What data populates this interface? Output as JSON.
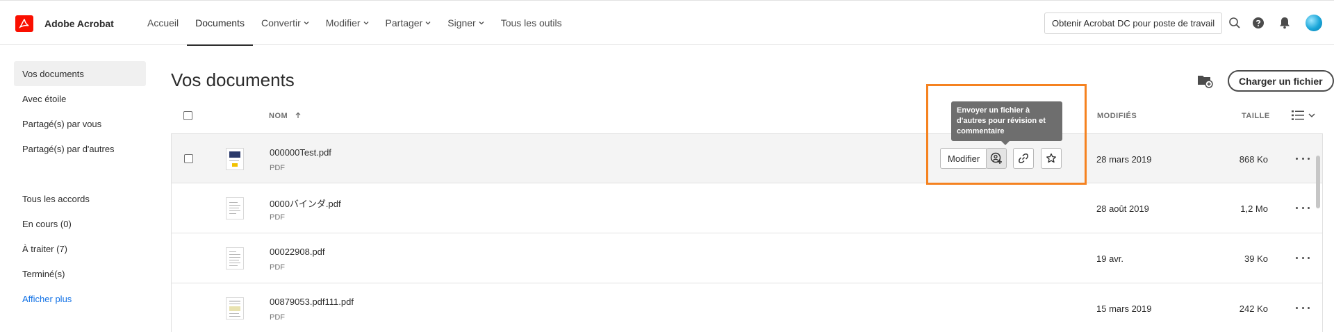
{
  "app": {
    "name": "Adobe Acrobat"
  },
  "nav": [
    {
      "label": "Accueil",
      "dropdown": false,
      "active": false
    },
    {
      "label": "Documents",
      "dropdown": false,
      "active": true
    },
    {
      "label": "Convertir",
      "dropdown": true,
      "active": false
    },
    {
      "label": "Modifier",
      "dropdown": true,
      "active": false
    },
    {
      "label": "Partager",
      "dropdown": true,
      "active": false
    },
    {
      "label": "Signer",
      "dropdown": true,
      "active": false
    },
    {
      "label": "Tous les outils",
      "dropdown": false,
      "active": false
    }
  ],
  "header": {
    "get_desktop_label": "Obtenir Acrobat DC pour poste de travail",
    "icons": [
      "search-icon",
      "help-icon",
      "bell-icon",
      "avatar"
    ]
  },
  "sidebar": {
    "items": [
      {
        "label": "Vos documents",
        "active": true
      },
      {
        "label": "Avec étoile"
      },
      {
        "label": "Partagé(s) par vous"
      },
      {
        "label": "Partagé(s) par d'autres"
      }
    ],
    "agreements": [
      {
        "label": "Tous les accords"
      },
      {
        "label": "En cours (0)"
      },
      {
        "label": "À traiter (7)"
      },
      {
        "label": "Terminé(s)"
      },
      {
        "label": "Afficher plus",
        "link": true
      }
    ]
  },
  "main": {
    "title": "Vos documents",
    "upload_label": "Charger un fichier",
    "columns": {
      "name": "NOM",
      "modified": "MODIFIÉS",
      "size": "TAILLE"
    }
  },
  "rows": [
    {
      "name": "000000Test.pdf",
      "type": "PDF",
      "modified": "28 mars 2019",
      "size": "868 Ko",
      "hovered": true
    },
    {
      "name": "0000バインダ.pdf",
      "type": "PDF",
      "modified": "28 août 2019",
      "size": "1,2 Mo"
    },
    {
      "name": "00022908.pdf",
      "type": "PDF",
      "modified": "19 avr.",
      "size": "39 Ko"
    },
    {
      "name": "00879053.pdf111.pdf",
      "type": "PDF",
      "modified": "15 mars 2019",
      "size": "242 Ko"
    }
  ],
  "row_actions": {
    "modifier_label": "Modifier",
    "tooltip": "Envoyer un fichier à d'autres pour révision et commentaire"
  },
  "colors": {
    "brand": "#fa0f00",
    "highlight": "#f58220",
    "link": "#1473e6",
    "tooltip_bg": "#6e6e6e"
  }
}
